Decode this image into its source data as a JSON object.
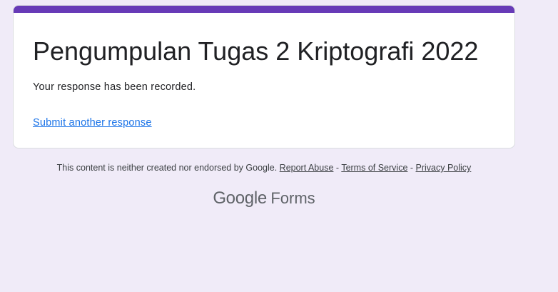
{
  "form": {
    "title": "Pengumpulan Tugas 2 Kriptografi 2022",
    "confirmation": "Your response has been recorded.",
    "submit_another_label": "Submit another response"
  },
  "footer": {
    "disclaimer": "This content is neither created nor endorsed by Google.",
    "separator": " - ",
    "report_abuse": "Report Abuse",
    "terms": "Terms of Service",
    "privacy": "Privacy Policy"
  },
  "brand": {
    "google": "Google",
    "forms": "Forms"
  },
  "colors": {
    "background": "#f0ebf8",
    "accent": "#673ab7",
    "link": "#1a73e8",
    "text": "#202124",
    "muted": "#5f6368"
  }
}
